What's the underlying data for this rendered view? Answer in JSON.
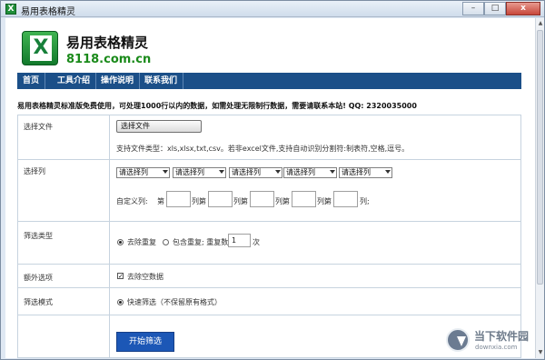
{
  "window": {
    "title": "易用表格精灵",
    "icon_label": "X",
    "controls": {
      "minimize": "–",
      "maximize": "□",
      "close": "x"
    }
  },
  "header": {
    "logo_letter": "X",
    "site_name": "易用表格精灵",
    "site_domain": "8118.com.cn"
  },
  "nav": {
    "items": [
      {
        "label": "首页"
      },
      {
        "label": "工具介绍"
      },
      {
        "label": "操作说明"
      },
      {
        "label": "联系我们"
      }
    ]
  },
  "notice": "易用表格精灵标准版免费使用，可处理1000行以内的数据，如需处理无限制行数据，需要请联系本站! QQ: 2320035000",
  "form": {
    "file": {
      "label": "选择文件",
      "button": "选择文件",
      "hint": "支持文件类型：xls,xlsx,txt,csv。若非excel文件,支持自动识别分割符:制表符,空格,逗号。"
    },
    "columns": {
      "label": "选择列",
      "selects": [
        "请选择列",
        "请选择列",
        "请选择列",
        "请选择列",
        "请选择列"
      ],
      "custom_label": "自定义列:",
      "prefix": "第",
      "suffix": "列;",
      "last_suffix": "列;"
    },
    "filter_type": {
      "label": "筛选类型",
      "options": [
        {
          "label": "去除重复",
          "checked": true
        },
        {
          "label": "包含重复; 重复数",
          "checked": false
        }
      ],
      "repeat_count": "1",
      "unit": "次"
    },
    "extra": {
      "label": "额外选项",
      "option": "去除空数据",
      "checked": true
    },
    "mode": {
      "label": "筛选模式",
      "option": "快速筛选（不保留原有格式）",
      "checked": true
    },
    "start_button": "开始筛选"
  },
  "watermark": {
    "name": "当下软件园",
    "url": "downxia.com"
  }
}
